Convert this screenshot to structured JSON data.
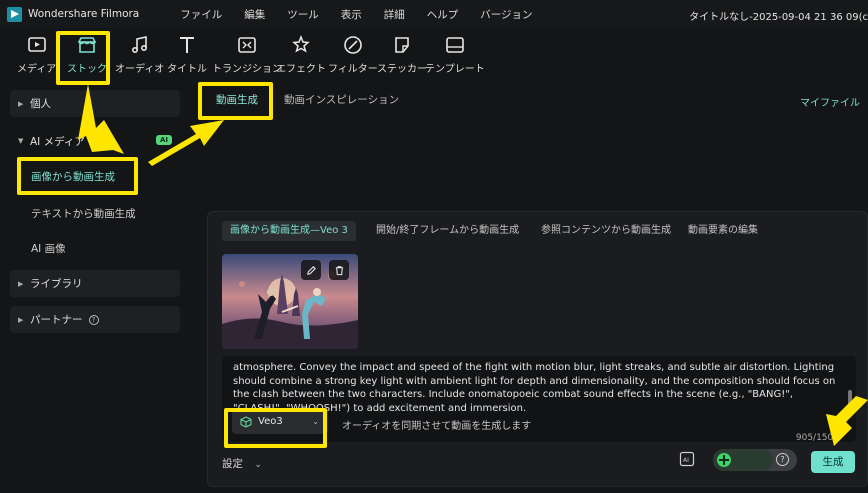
{
  "titlebar": {
    "app_name": "Wondershare Filmora",
    "menu": [
      "ファイル",
      "編集",
      "ツール",
      "表示",
      "詳細",
      "ヘルプ",
      "バージョン"
    ],
    "project_title": "タイトルなし-2025-09-04 21 36 09(c"
  },
  "toolbar": {
    "items": [
      {
        "label": "メディア",
        "icon": "media-icon"
      },
      {
        "label": "ストック",
        "icon": "stock-store-icon"
      },
      {
        "label": "オーディオ",
        "icon": "music-note-icon"
      },
      {
        "label": "タイトル",
        "icon": "title-t-icon"
      },
      {
        "label": "トランジション",
        "icon": "transition-icon"
      },
      {
        "label": "エフェクト",
        "icon": "effects-star-icon"
      },
      {
        "label": "フィルター",
        "icon": "filter-icon"
      },
      {
        "label": "ステッカー",
        "icon": "sticker-icon"
      },
      {
        "label": "テンプレート",
        "icon": "template-icon"
      }
    ],
    "active": "ストック"
  },
  "sidebar": {
    "personal": "個人",
    "ai_media": "AI メディア",
    "ai_badge": "AI",
    "sub_items": [
      "画像から動画生成",
      "テキストから動画生成",
      "AI 画像"
    ],
    "library": "ライブラリ",
    "partner": "パートナー",
    "help_glyph": "?"
  },
  "content_tabs": {
    "tabs": [
      "動画生成",
      "動画インスピレーション"
    ],
    "my_files": "マイファイル"
  },
  "generator": {
    "tabs": [
      "画像から動画生成—Veo 3",
      "開始/終了フレームから動画生成",
      "参照コンテンツから動画生成",
      "動画要素の編集"
    ],
    "prompt_text": "atmosphere. Convey the impact and speed of the fight with motion blur, light streaks, and subtle air distortion. Lighting should combine a strong key light with ambient light for depth and dimensionality, and the composition should focus on the clash between the two characters. Include onomatopoeic combat sound effects in the scene (e.g., \"BANG!\", \"CLASH!\", \"WHOOSH!\") to add excitement and immersion.",
    "model": "Veo3",
    "audio_hint": "オーディオを同期させて動画を生成します",
    "counter": "905/1500",
    "settings_label": "設定",
    "generate_label": "生成",
    "help_glyph": "?"
  },
  "colors": {
    "accent": "#7fe0cf",
    "generate_button": "#6fe0cc",
    "highlight": "#ffe600",
    "ai_badge": "#56d47a"
  }
}
